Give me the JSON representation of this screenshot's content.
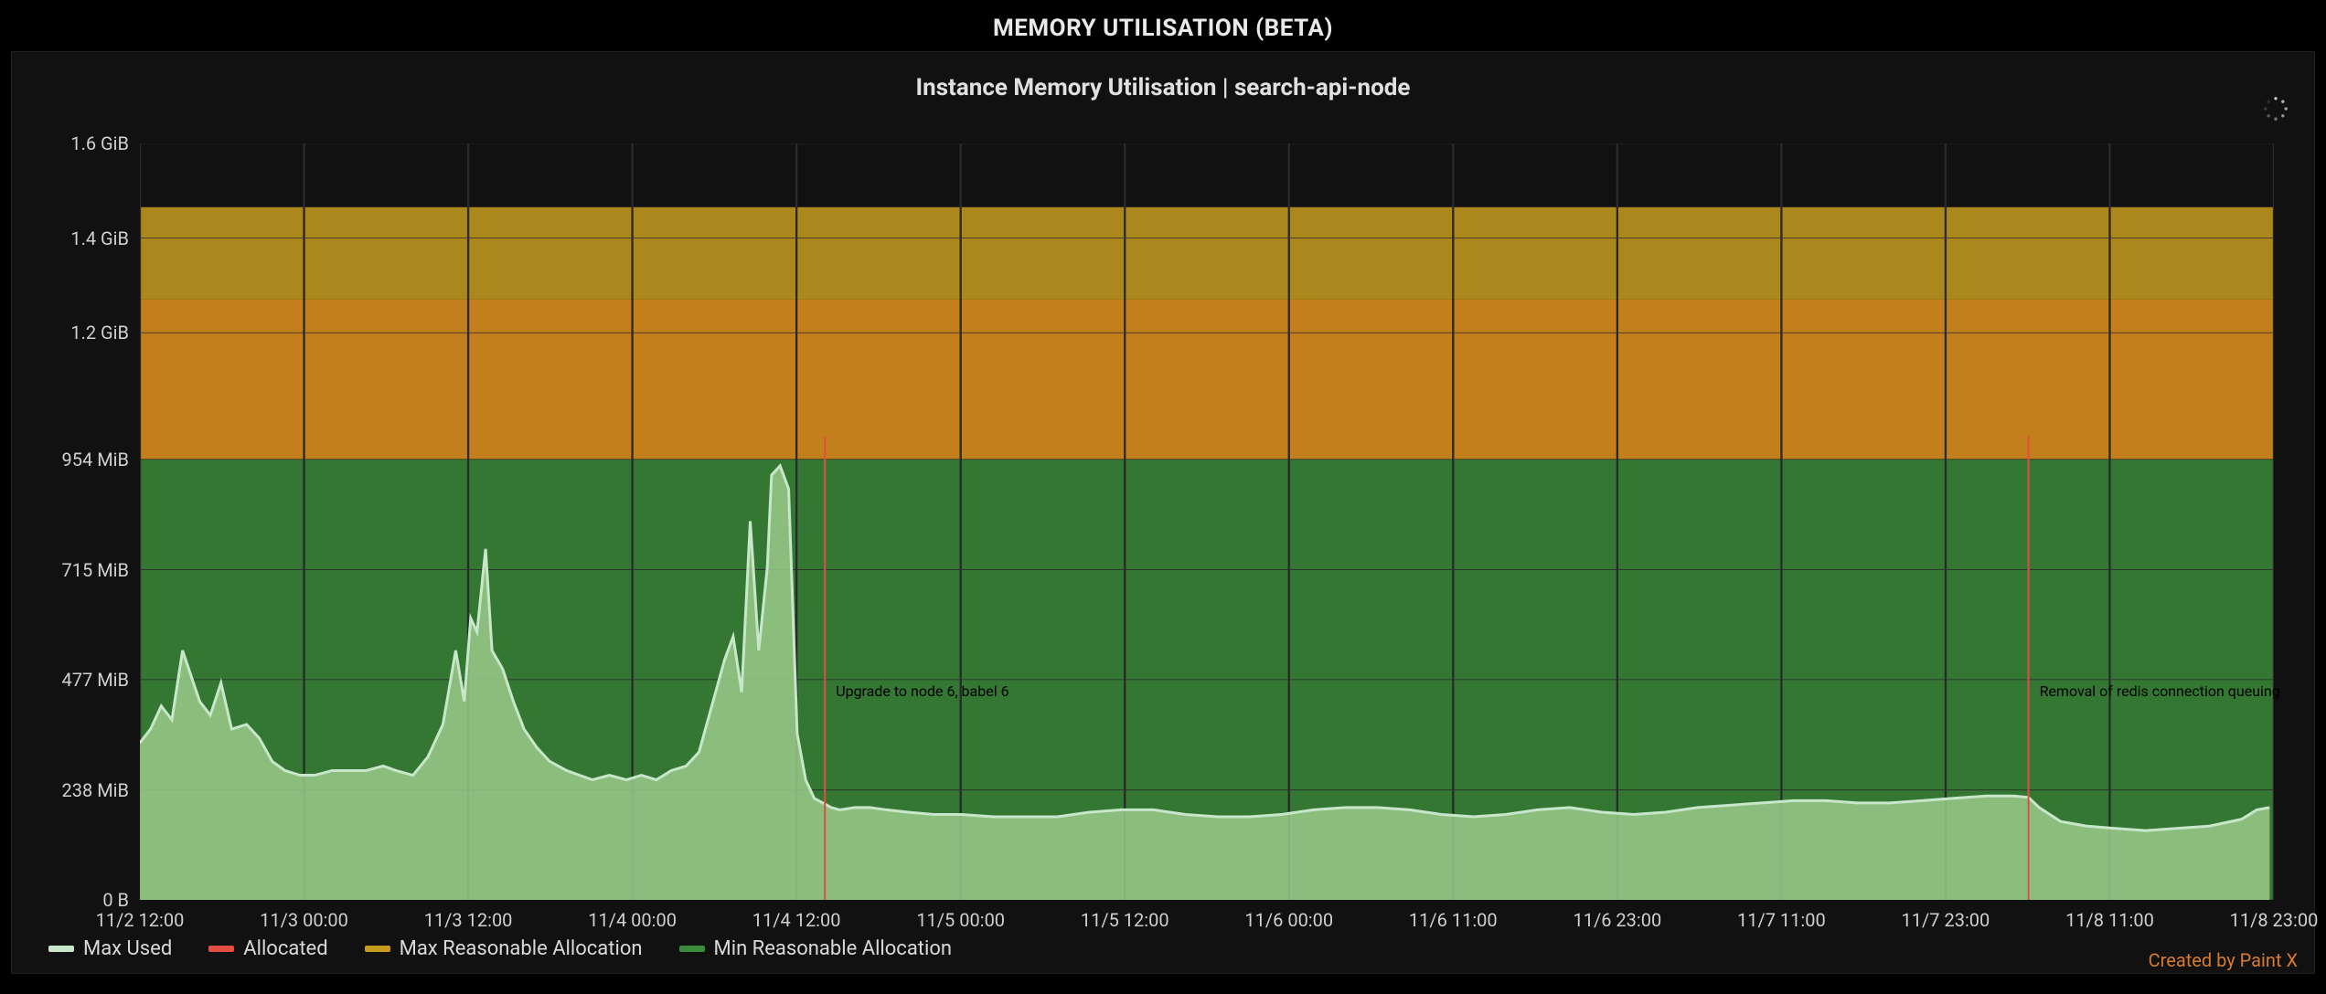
{
  "panel_title": "MEMORY UTILISATION (BETA)",
  "chart_title": "Instance Memory Utilisation | search-api-node",
  "credit": "Created by Paint X",
  "legend": {
    "max_used": "Max Used",
    "allocated": "Allocated",
    "max_reasonable": "Max Reasonable Allocation",
    "min_reasonable": "Min Reasonable Allocation"
  },
  "colors": {
    "max_used_line": "#c8e6c9",
    "max_used_fill": "#9bca8a",
    "allocated": "#e24d42",
    "max_reasonable_band": "#c79c1e",
    "mid_band": "#d88c1f",
    "min_reasonable_band": "#3a8a3a",
    "annotation_line": "#e24d42"
  },
  "annotations": [
    {
      "x": "11/4 15:00",
      "x_frac": 0.321,
      "label": "Upgrade to node 6, babel 6"
    },
    {
      "x": "11/8 12:30",
      "x_frac": 0.885,
      "label": "Removal of redis connection queuing"
    }
  ],
  "chart_data": {
    "type": "area",
    "title": "Instance Memory Utilisation | search-api-node",
    "xlabel": "",
    "ylabel": "",
    "x_ticks": [
      "11/2 12:00",
      "11/3 00:00",
      "11/3 12:00",
      "11/4 00:00",
      "11/4 12:00",
      "11/5 00:00",
      "11/5 12:00",
      "11/6 00:00",
      "11/6 11:00",
      "11/6 23:00",
      "11/7 11:00",
      "11/7 23:00",
      "11/8 11:00",
      "11/8 23:00"
    ],
    "y_ticks": [
      "0 B",
      "238 MiB",
      "477 MiB",
      "715 MiB",
      "954 MiB",
      "1.2 GiB",
      "1.4 GiB",
      "1.6 GiB"
    ],
    "y_tick_values_mib": [
      0,
      238,
      477,
      715,
      954,
      1228,
      1433,
      1638
    ],
    "ylim_mib": [
      0,
      1638
    ],
    "bands": {
      "max_reasonable_allocation_mib": 1500,
      "band_divider_mib": 1300,
      "min_reasonable_allocation_mib": 954
    },
    "series": [
      {
        "name": "Max Used",
        "unit": "MiB",
        "x_frac": [
          0.0,
          0.005,
          0.01,
          0.015,
          0.02,
          0.028,
          0.033,
          0.038,
          0.043,
          0.05,
          0.056,
          0.062,
          0.068,
          0.075,
          0.082,
          0.09,
          0.098,
          0.106,
          0.114,
          0.12,
          0.128,
          0.135,
          0.142,
          0.148,
          0.152,
          0.155,
          0.158,
          0.162,
          0.165,
          0.17,
          0.175,
          0.18,
          0.186,
          0.192,
          0.2,
          0.206,
          0.212,
          0.22,
          0.228,
          0.235,
          0.242,
          0.249,
          0.256,
          0.262,
          0.268,
          0.274,
          0.278,
          0.282,
          0.286,
          0.29,
          0.294,
          0.296,
          0.3,
          0.304,
          0.308,
          0.312,
          0.316,
          0.32,
          0.324,
          0.328,
          0.335,
          0.342,
          0.35,
          0.36,
          0.372,
          0.385,
          0.4,
          0.415,
          0.43,
          0.445,
          0.46,
          0.475,
          0.49,
          0.505,
          0.52,
          0.535,
          0.55,
          0.565,
          0.58,
          0.595,
          0.61,
          0.625,
          0.64,
          0.655,
          0.67,
          0.685,
          0.7,
          0.715,
          0.73,
          0.745,
          0.76,
          0.775,
          0.79,
          0.805,
          0.82,
          0.835,
          0.85,
          0.865,
          0.878,
          0.885,
          0.89,
          0.9,
          0.912,
          0.925,
          0.94,
          0.955,
          0.97,
          0.985,
          0.992,
          0.998
        ],
        "values": [
          340,
          370,
          420,
          390,
          540,
          430,
          400,
          470,
          370,
          380,
          350,
          300,
          280,
          270,
          270,
          280,
          280,
          280,
          290,
          280,
          270,
          310,
          380,
          540,
          430,
          610,
          580,
          760,
          540,
          500,
          430,
          370,
          330,
          300,
          280,
          270,
          260,
          270,
          260,
          270,
          260,
          280,
          290,
          320,
          420,
          520,
          570,
          450,
          820,
          540,
          720,
          920,
          940,
          890,
          360,
          260,
          220,
          210,
          200,
          195,
          200,
          200,
          195,
          190,
          185,
          185,
          180,
          180,
          180,
          190,
          195,
          195,
          185,
          180,
          180,
          185,
          195,
          200,
          200,
          195,
          185,
          180,
          185,
          195,
          200,
          190,
          185,
          190,
          200,
          205,
          210,
          215,
          215,
          210,
          210,
          215,
          220,
          225,
          225,
          222,
          200,
          170,
          160,
          155,
          150,
          155,
          160,
          175,
          195,
          200
        ]
      },
      {
        "name": "Allocated",
        "unit": "MiB",
        "note": "constant, line not visibly distinguishable in screenshot; colored red in legend",
        "value": null
      },
      {
        "name": "Max Reasonable Allocation",
        "unit": "MiB",
        "value": 1500
      },
      {
        "name": "Min Reasonable Allocation",
        "unit": "MiB",
        "value": 954
      }
    ]
  }
}
